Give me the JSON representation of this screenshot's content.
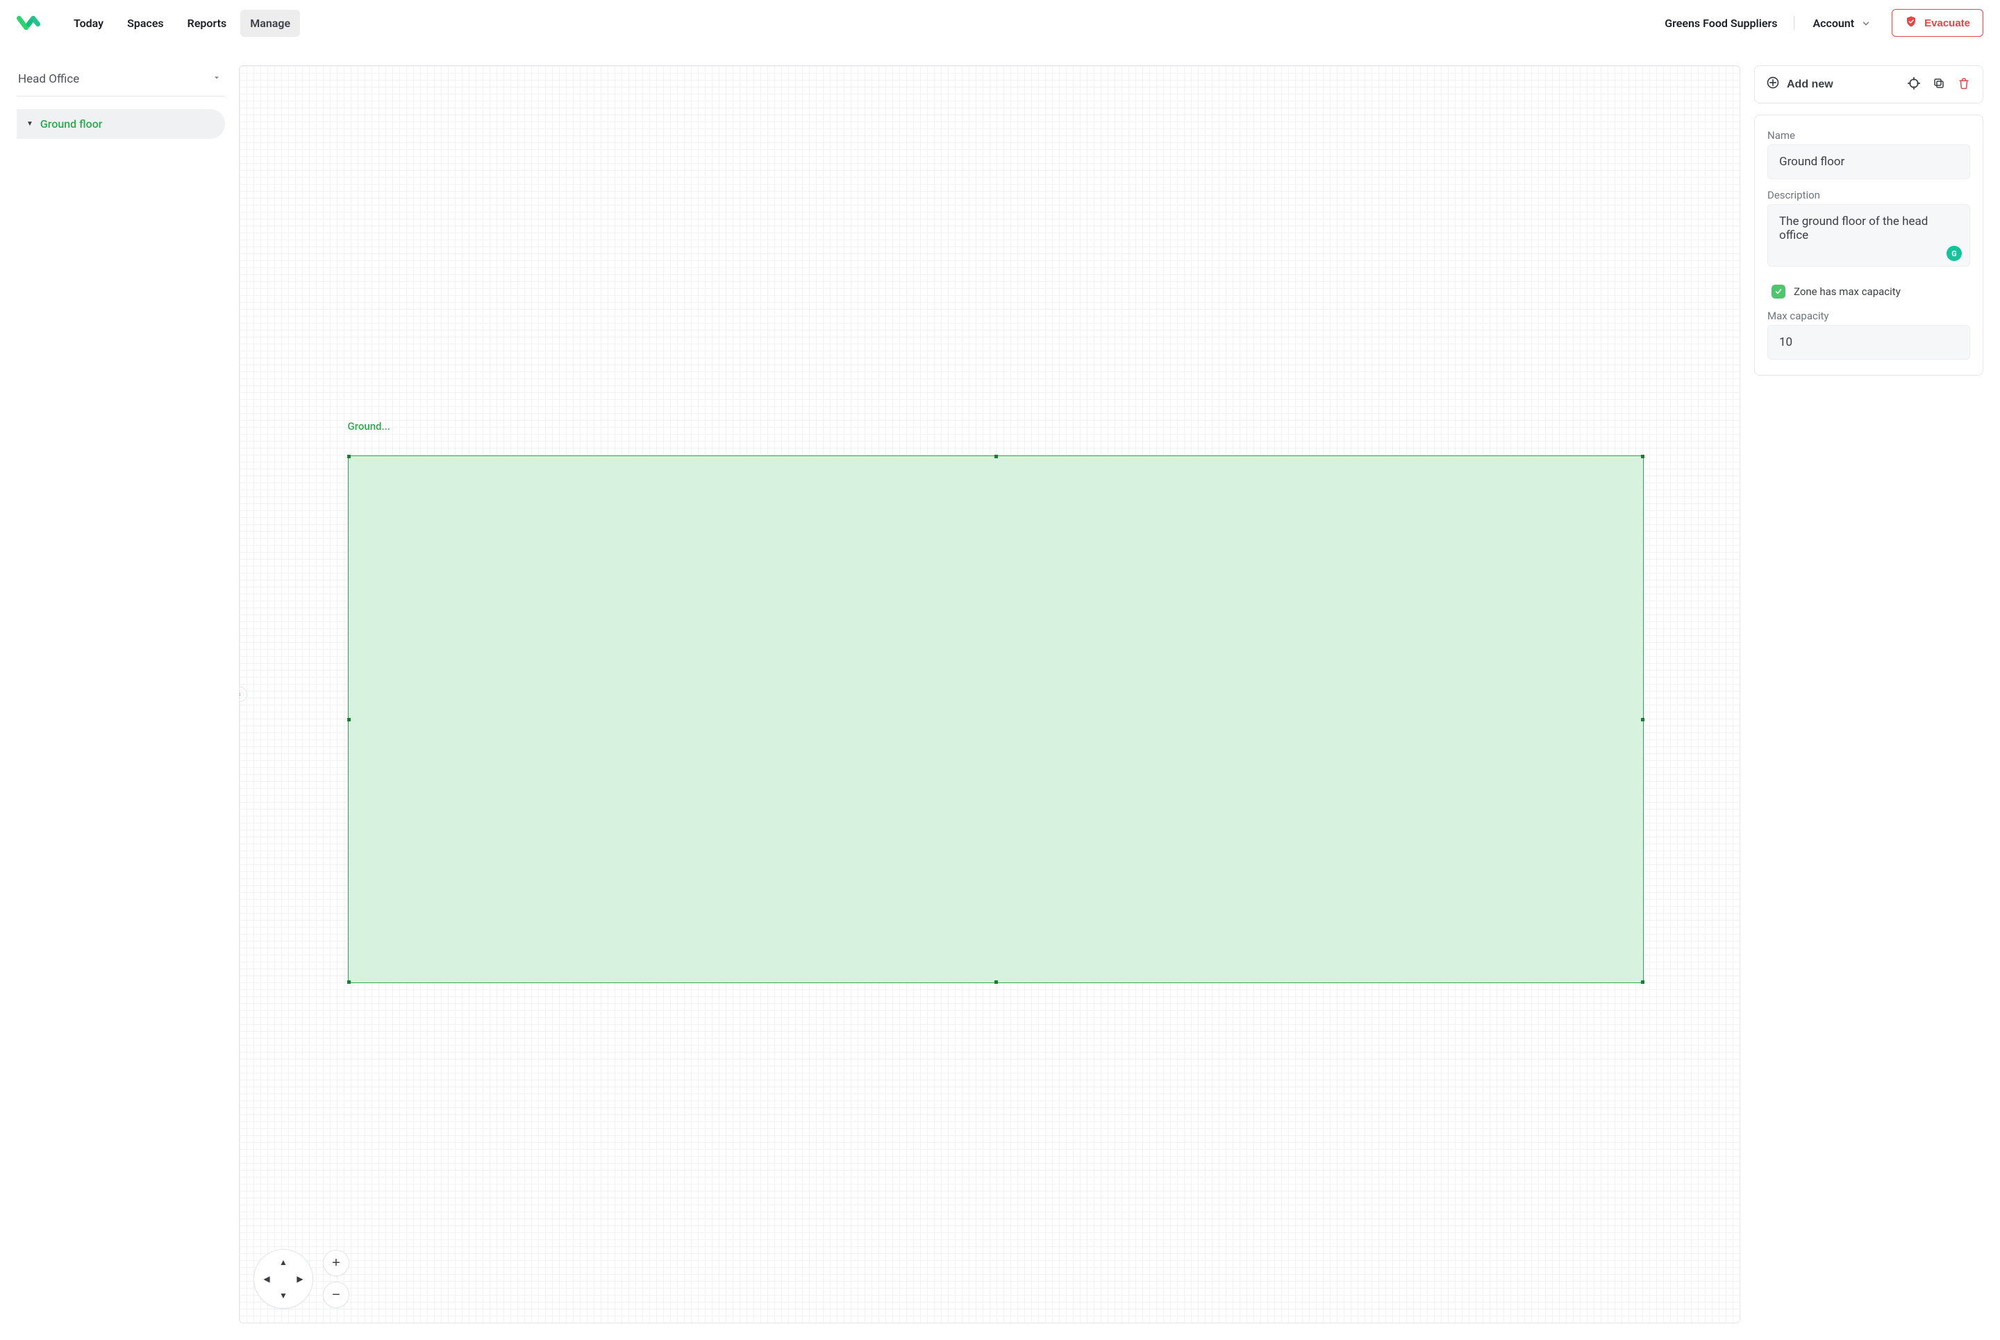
{
  "nav": {
    "today": "Today",
    "spaces": "Spaces",
    "reports": "Reports",
    "manage": "Manage"
  },
  "org": "Greens Food Suppliers",
  "account_label": "Account",
  "evacuate_label": "Evacuate",
  "sidebar": {
    "location": "Head Office",
    "floor": "Ground floor"
  },
  "canvas": {
    "zone_label": "Ground..."
  },
  "toolbar": {
    "add_new": "Add new"
  },
  "form": {
    "name_label": "Name",
    "name_value": "Ground floor",
    "description_label": "Description",
    "description_value": "The ground floor of the head office",
    "max_capacity_checkbox_label": "Zone has max capacity",
    "max_capacity_label": "Max capacity",
    "max_capacity_value": "10"
  }
}
